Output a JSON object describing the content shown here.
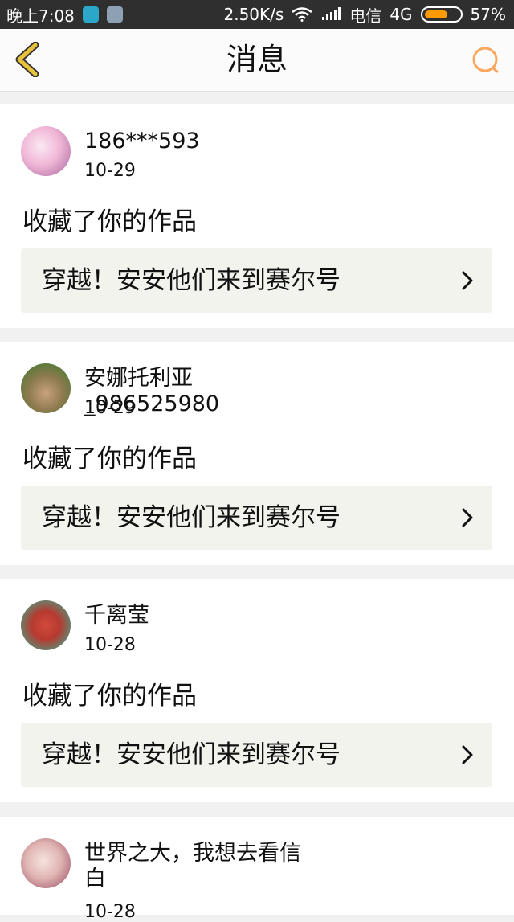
{
  "status_bar": {
    "time": "晚上7:08",
    "speed": "2.50K/s",
    "carrier": "电信",
    "network": "4G",
    "battery": "57%",
    "icons": [
      "shield-icon",
      "doc-icon",
      "wifi-icon",
      "signal-icon",
      "battery-icon"
    ]
  },
  "header": {
    "title": "消息",
    "accent_color": "#f7a85c",
    "back_icon_color": "#e8c23a"
  },
  "messages": [
    {
      "user": "186***593",
      "date": "10-29",
      "action": "收藏了你的作品",
      "work": "穿越！安安他们来到赛尔号"
    },
    {
      "user": "安娜托利亚_986525980",
      "date": "10-29",
      "action": "收藏了你的作品",
      "work": "穿越！安安他们来到赛尔号"
    },
    {
      "user": "千离莹",
      "date": "10-28",
      "action": "收藏了你的作品",
      "work": "穿越！安安他们来到赛尔号"
    },
    {
      "user": "世界之大，我想去看信白",
      "date": "10-28"
    }
  ]
}
